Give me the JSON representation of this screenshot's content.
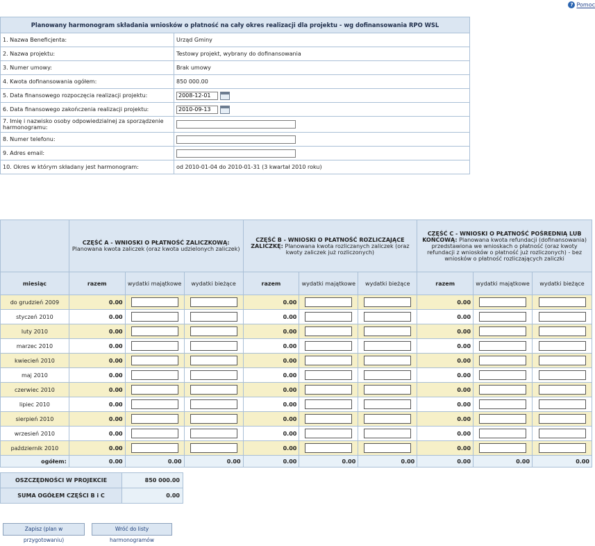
{
  "help": {
    "label": "Pomoc"
  },
  "info": {
    "title": "Planowany harmonogram składania wniosków o płatność na cały okres realizacji dla projektu - wg dofinansowania RPO WSL",
    "rows": [
      {
        "label": "1. Nazwa Beneficjenta:",
        "value": "Urząd Gminy"
      },
      {
        "label": "2. Nazwa projektu:",
        "value": "Testowy projekt, wybrany do dofinansowania"
      },
      {
        "label": "3. Numer umowy:",
        "value": "Brak umowy"
      },
      {
        "label": "4. Kwota dofinansowania ogółem:",
        "value": "850 000.00"
      },
      {
        "label": "5. Data finansowego rozpoczęcia realizacji projektu:",
        "value": "2008-12-01"
      },
      {
        "label": "6. Data finansowego zakończenia realizacji projektu:",
        "value": "2010-09-13"
      },
      {
        "label": "7. Imię i nazwisko osoby odpowiedzialnej za sporządzenie harmonogramu:",
        "value": ""
      },
      {
        "label": "8. Numer telefonu:",
        "value": ""
      },
      {
        "label": "9. Adres email:",
        "value": ""
      },
      {
        "label": "10. Okres w którym składany jest harmonogram:",
        "value": "od 2010-01-04 do 2010-01-31 (3 kwartał 2010 roku)"
      }
    ]
  },
  "schedule": {
    "partA": {
      "title": "CZĘŚĆ A - WNIOSKI O PŁATNOŚĆ ZALICZKOWĄ:",
      "desc": "Planowana kwota zaliczek (oraz kwota udzielonych zaliczek)"
    },
    "partB": {
      "title": "CZĘŚĆ B - WNIOSKI O PŁATNOŚĆ ROZLICZAJĄCE ZALICZKĘ:",
      "desc": "Planowana kwota rozliczanych zaliczek (oraz kwoty zaliczek już rozliczonych)"
    },
    "partC": {
      "title": "CZĘŚĆ C - WNIOSKI O PŁATNOŚĆ POŚREDNIĄ LUB KOŃCOWĄ:",
      "desc": "Planowana kwota refundacji (dofinansowania) przedstawiona we wnioskach o płatność (oraz kwoty refundacji z wniosków o płatność już rozliczonych) - bez wniosków o płatność rozliczających zaliczki"
    },
    "headers": {
      "month": "miesiąc",
      "total": "razem",
      "capex": "wydatki majątkowe",
      "opex": "wydatki bieżące"
    },
    "months": [
      {
        "name": "do grudzień 2009",
        "a": "0.00",
        "b": "0.00",
        "c": "0.00"
      },
      {
        "name": "styczeń 2010",
        "a": "0.00",
        "b": "0.00",
        "c": "0.00"
      },
      {
        "name": "luty 2010",
        "a": "0.00",
        "b": "0.00",
        "c": "0.00"
      },
      {
        "name": "marzec 2010",
        "a": "0.00",
        "b": "0.00",
        "c": "0.00"
      },
      {
        "name": "kwiecień 2010",
        "a": "0.00",
        "b": "0.00",
        "c": "0.00"
      },
      {
        "name": "maj 2010",
        "a": "0.00",
        "b": "0.00",
        "c": "0.00"
      },
      {
        "name": "czerwiec 2010",
        "a": "0.00",
        "b": "0.00",
        "c": "0.00"
      },
      {
        "name": "lipiec 2010",
        "a": "0.00",
        "b": "0.00",
        "c": "0.00"
      },
      {
        "name": "sierpień 2010",
        "a": "0.00",
        "b": "0.00",
        "c": "0.00"
      },
      {
        "name": "wrzesień 2010",
        "a": "0.00",
        "b": "0.00",
        "c": "0.00"
      },
      {
        "name": "październik 2010",
        "a": "0.00",
        "b": "0.00",
        "c": "0.00"
      }
    ],
    "totals": {
      "label": "ogółem:",
      "values": [
        "0.00",
        "0.00",
        "0.00",
        "0.00",
        "0.00",
        "0.00",
        "0.00",
        "0.00",
        "0.00"
      ]
    }
  },
  "summary": [
    {
      "label": "OSZCZĘDNOŚCI W PROJEKCIE",
      "value": "850 000.00"
    },
    {
      "label": "SUMA OGÓŁEM CZĘŚCI B i C",
      "value": "0.00"
    }
  ],
  "buttons": {
    "save": "Zapisz (plan w przygotowaniu)",
    "back": "Wróć do listy harmonogramów"
  }
}
